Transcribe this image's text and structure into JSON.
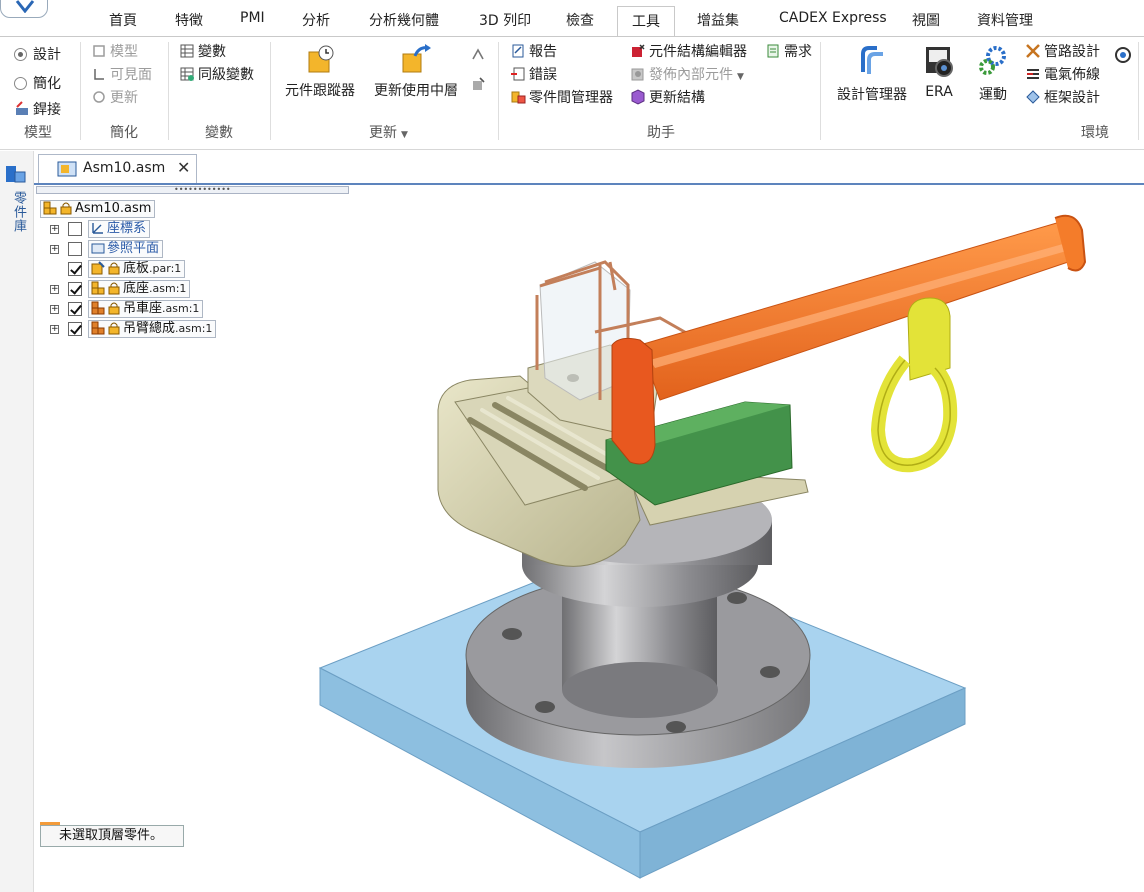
{
  "ribbon": {
    "tabs": [
      "首頁",
      "特徵",
      "PMI",
      "分析",
      "分析幾何體",
      "3D 列印",
      "檢查",
      "工具",
      "增益集",
      "CADEX Express",
      "視圖",
      "資料管理"
    ],
    "active_tab": "工具",
    "groups": {
      "model": {
        "label": "模型",
        "design": "設計",
        "simplify": "簡化",
        "weld": "銲接"
      },
      "simplify": {
        "label": "簡化",
        "model": "模型",
        "visible_face": "可見面",
        "update": "更新"
      },
      "variables": {
        "label": "變數",
        "variables": "變數",
        "peer_variables": "同級變數"
      },
      "update": {
        "label": "更新",
        "component_tracker": "元件跟蹤器",
        "update_active_level": "更新使用中層"
      },
      "assistant": {
        "label": "助手",
        "reports": "報告",
        "errors": "錯誤",
        "interpart_manager": "零件間管理器",
        "structure_editor": "元件結構編輯器",
        "publish_virtual": "發佈內部元件",
        "update_structure": "更新結構",
        "requirements": "需求"
      },
      "environment": {
        "label": "環境",
        "design_manager": "設計管理器",
        "era": "ERA",
        "motion": "運動",
        "piping": "管路設計",
        "wire_harness": "電氣佈線",
        "frame": "框架設計"
      }
    }
  },
  "sidebar": {
    "library_label": "零件庫"
  },
  "document": {
    "tab_name": "Asm10.asm"
  },
  "tree": {
    "root": "Asm10.asm",
    "items": [
      {
        "label": "座標系",
        "ext": "",
        "checked": false,
        "expandable": true
      },
      {
        "label": "參照平面",
        "ext": "",
        "checked": false,
        "expandable": true
      },
      {
        "label": "底板",
        "ext": ".par:1",
        "checked": true,
        "expandable": false
      },
      {
        "label": "底座",
        "ext": ".asm:1",
        "checked": true,
        "expandable": true
      },
      {
        "label": "吊車座",
        "ext": ".asm:1",
        "checked": true,
        "expandable": true
      },
      {
        "label": "吊臂總成",
        "ext": ".asm:1",
        "checked": true,
        "expandable": true
      }
    ]
  },
  "status": {
    "message": "未選取頂層零件。"
  },
  "colors": {
    "active_tab_line": "#5d84bd",
    "status_accent": "#f39b3a",
    "boom": "#f47c2a",
    "base_plate": "#9dcbe8",
    "hook": "#e8e33a",
    "green_block": "#3e8a3e",
    "cab_body": "#d8d4b2"
  }
}
